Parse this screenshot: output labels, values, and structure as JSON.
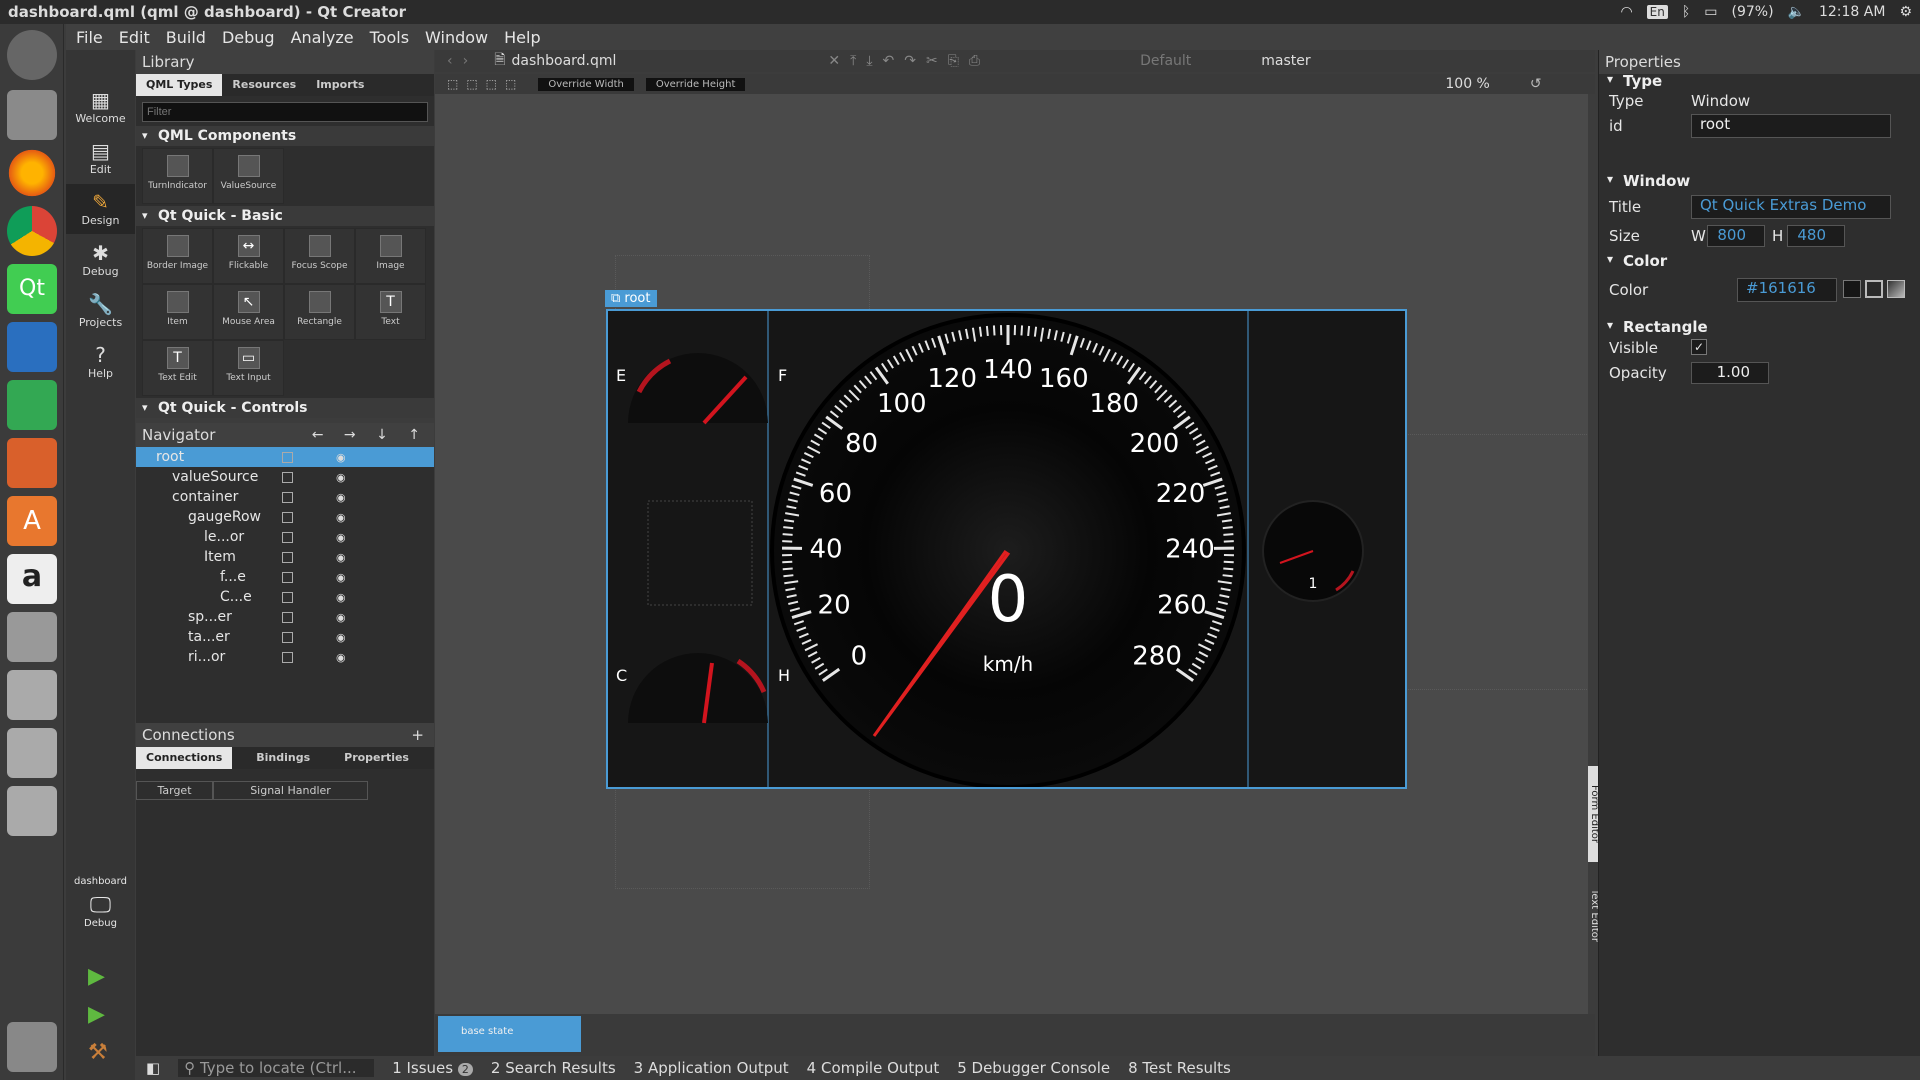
{
  "window_title": "dashboard.qml (qml @ dashboard) - Qt Creator",
  "tray": {
    "keyboard": "En",
    "battery": "(97%)",
    "time": "12:18 AM"
  },
  "menu": [
    "File",
    "Edit",
    "Build",
    "Debug",
    "Analyze",
    "Tools",
    "Window",
    "Help"
  ],
  "modes": [
    {
      "label": "Welcome",
      "icon": "grid-icon"
    },
    {
      "label": "Edit",
      "icon": "document-icon"
    },
    {
      "label": "Design",
      "icon": "pencil-icon"
    },
    {
      "label": "Debug",
      "icon": "bug-icon"
    },
    {
      "label": "Projects",
      "icon": "wrench-icon"
    },
    {
      "label": "Help",
      "icon": "help-icon"
    }
  ],
  "kit": {
    "project": "dashboard",
    "mode": "Debug"
  },
  "library": {
    "title": "Library",
    "tabs": [
      "QML Types",
      "Resources",
      "Imports"
    ],
    "filter_placeholder": "Filter",
    "sections": [
      {
        "name": "QML Components",
        "items": [
          "TurnIndicator",
          "ValueSource"
        ]
      },
      {
        "name": "Qt Quick - Basic",
        "items": [
          "Border Image",
          "Flickable",
          "Focus Scope",
          "Image",
          "Item",
          "Mouse Area",
          "Rectangle",
          "Text",
          "Text Edit",
          "Text Input"
        ]
      },
      {
        "name": "Qt Quick - Controls",
        "items": []
      }
    ]
  },
  "navigator": {
    "title": "Navigator",
    "nodes": [
      {
        "label": "root",
        "depth": 0
      },
      {
        "label": "valueSource",
        "depth": 1
      },
      {
        "label": "container",
        "depth": 1
      },
      {
        "label": "gaugeRow",
        "depth": 2
      },
      {
        "label": "le...or",
        "depth": 3
      },
      {
        "label": "Item",
        "depth": 3
      },
      {
        "label": "f...e",
        "depth": 4
      },
      {
        "label": "C...e",
        "depth": 4
      },
      {
        "label": "sp...er",
        "depth": 2
      },
      {
        "label": "ta...er",
        "depth": 2
      },
      {
        "label": "ri...or",
        "depth": 2
      }
    ]
  },
  "connections": {
    "title": "Connections",
    "tabs": [
      "Connections",
      "Bindings",
      "Properties"
    ],
    "columns": [
      "Target",
      "Signal Handler"
    ]
  },
  "editor": {
    "filename": "dashboard.qml",
    "state_combo": "Default",
    "branch": "master",
    "override_width": "Override Width",
    "override_height": "Override Height",
    "zoom": "100 %"
  },
  "canvas": {
    "root_label": "root",
    "speed_value": "0",
    "speed_unit": "km/h",
    "speed_ticks": [
      "0",
      "20",
      "40",
      "60",
      "80",
      "100",
      "120",
      "140",
      "160",
      "180",
      "200",
      "220",
      "240",
      "260",
      "280"
    ],
    "fuel": {
      "left": "E",
      "right": "F"
    },
    "temp": {
      "left": "C",
      "right": "H"
    },
    "tacho": {
      "value": "1"
    }
  },
  "states": {
    "base": "base state"
  },
  "properties": {
    "title": "Properties",
    "type_section": "Type",
    "type_label": "Type",
    "type_value": "Window",
    "id_label": "id",
    "id_value": "root",
    "window_section": "Window",
    "title_label": "Title",
    "title_value": "Qt Quick Extras Demo",
    "size_label": "Size",
    "w": "800",
    "h": "480",
    "color_section": "Color",
    "color_label": "Color",
    "color_value": "#161616",
    "rect_section": "Rectangle",
    "visible_label": "Visible",
    "opacity_label": "Opacity",
    "opacity_value": "1.00"
  },
  "side_tabs": [
    "Form Editor",
    "Text Editor"
  ],
  "output": {
    "locate_placeholder": "Type to locate (Ctrl...",
    "panes": [
      {
        "label": "1  Issues",
        "badge": "2"
      },
      {
        "label": "2  Search Results"
      },
      {
        "label": "3  Application Output"
      },
      {
        "label": "4  Compile Output"
      },
      {
        "label": "5  Debugger Console"
      },
      {
        "label": "8  Test Results"
      }
    ]
  },
  "colors": {
    "accent": "#4a9bd5",
    "needle": "#c8141e",
    "gauge_bg": "#161616"
  }
}
